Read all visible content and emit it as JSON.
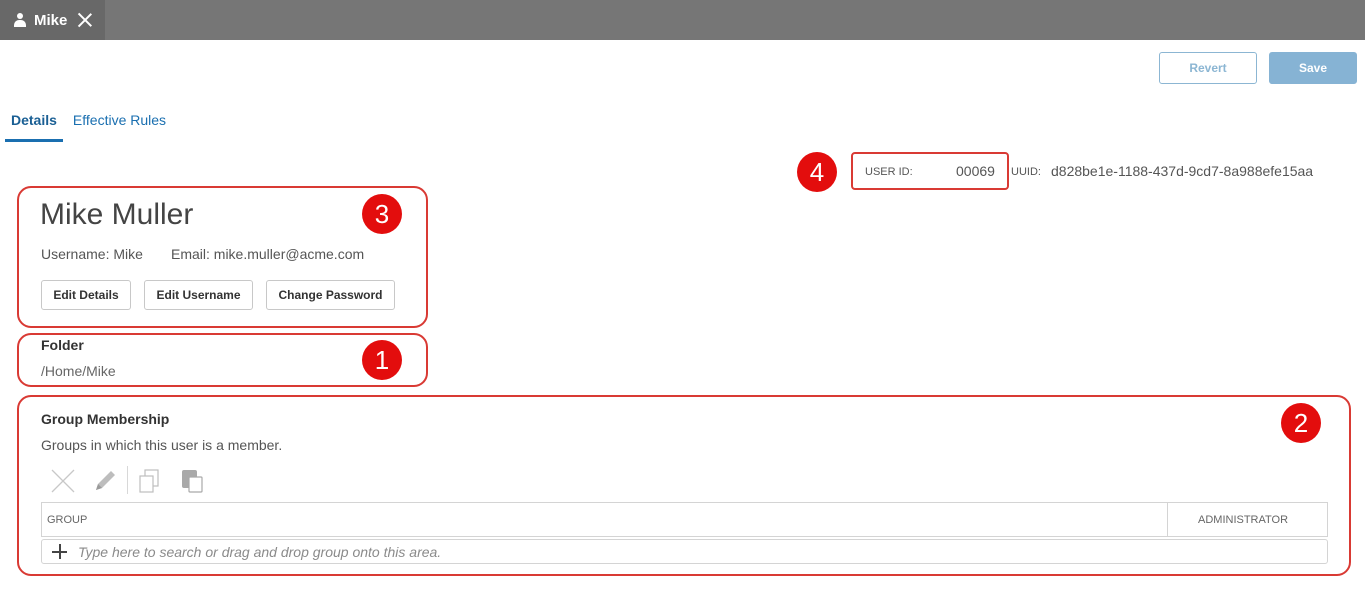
{
  "window": {
    "tab_label": "Mike",
    "tab_icon": "user-icon",
    "close_icon": "close-icon"
  },
  "toolbar": {
    "revert_label": "Revert",
    "save_label": "Save"
  },
  "tabs": [
    {
      "label": "Details",
      "active": true
    },
    {
      "label": "Effective Rules",
      "active": false
    }
  ],
  "ids": {
    "user_id_label": "USER ID:",
    "user_id_value": "00069",
    "uuid_label": "UUID:",
    "uuid_value": "d828be1e-1188-437d-9cd7-8a988efe15aa"
  },
  "user": {
    "full_name": "Mike Muller",
    "username_line": "Username: Mike",
    "email_line": "Email: mike.muller@acme.com",
    "buttons": {
      "edit_details": "Edit Details",
      "edit_username": "Edit Username",
      "change_password": "Change Password"
    }
  },
  "folder": {
    "title": "Folder",
    "path": "/Home/Mike"
  },
  "group_membership": {
    "title": "Group Membership",
    "description": "Groups in which this user is a member.",
    "tools": [
      "delete-icon",
      "edit-icon",
      "copy-icon",
      "paste-icon"
    ],
    "columns": [
      "GROUP",
      "ADMINISTRATOR"
    ],
    "add_placeholder": "Type here to search or drag and drop group onto this area."
  },
  "annotations": {
    "badges": [
      "1",
      "2",
      "3",
      "4"
    ],
    "color": "#e30d0d"
  },
  "colors": {
    "accent": "#1a6fb0",
    "topbar": "#767676",
    "active_tab_bg": "#686868",
    "save_button": "#86b3d4",
    "annotation_border": "#d93a34"
  }
}
